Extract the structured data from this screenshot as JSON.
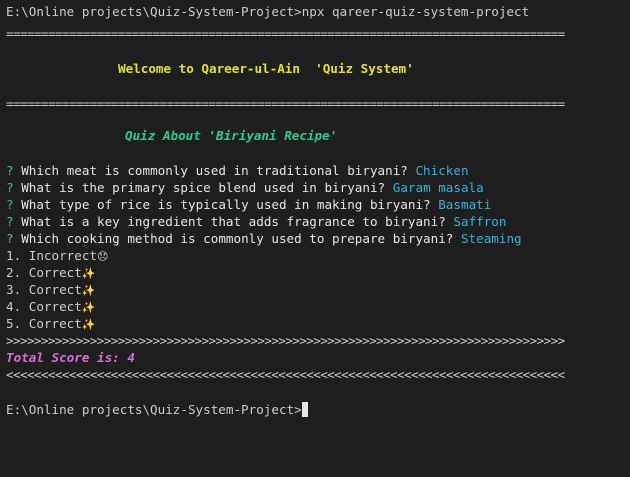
{
  "command_line": {
    "prompt": "E:\\Online projects\\Quiz-System-Project>",
    "command": "npx qareer-quiz-system-project"
  },
  "separator": "================================================================================",
  "welcome": "Welcome to Qareer-ul-Ain  'Quiz System'",
  "subtitle": "Quiz About 'Biriyani Recipe'",
  "questions": [
    {
      "mark": "?",
      "text": "Which meat is commonly used in traditional biryani?",
      "answer": "Chicken"
    },
    {
      "mark": "?",
      "text": "What is the primary spice blend used in biryani?",
      "answer": "Garam masala"
    },
    {
      "mark": "?",
      "text": "What type of rice is typically used in making biryani?",
      "answer": "Basmati"
    },
    {
      "mark": "?",
      "text": "What is a key ingredient that adds fragrance to biryani?",
      "answer": "Saffron"
    },
    {
      "mark": "?",
      "text": "Which cooking method is commonly used to prepare biryani?",
      "answer": "Steaming"
    }
  ],
  "results": [
    {
      "text": "1. Incorrect",
      "emoji": "😞"
    },
    {
      "text": "2. Correct",
      "emoji": "✨"
    },
    {
      "text": "3. Correct",
      "emoji": "✨"
    },
    {
      "text": "4. Correct",
      "emoji": "✨"
    },
    {
      "text": "5. Correct",
      "emoji": "✨"
    }
  ],
  "arrows_right": ">>>>>>>>>>>>>>>>>>>>>>>>>>>>>>>>>>>>>>>>>>>>>>>>>>>>>>>>>>>>>>>>>>>>>>>>>>>>>>>>",
  "total_score": "Total Score is: 4",
  "arrows_left": "<<<<<<<<<<<<<<<<<<<<<<<<<<<<<<<<<<<<<<<<<<<<<<<<<<<<<<<<<<<<<<<<<<<<<<<<<<<<<<<<",
  "final_prompt": "E:\\Online projects\\Quiz-System-Project>",
  "colors": {
    "background": "#1e1e1e",
    "welcome": "#e5e510",
    "subtitle": "#23d18b",
    "answer": "#29b8db",
    "score": "#d670d6"
  }
}
